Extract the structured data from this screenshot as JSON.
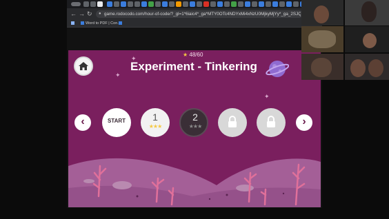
{
  "browser": {
    "url": "game.rodocodo.com/hour-of-code/?_gl=1*6iaic4*_ga*MTY0OTc4NDYxMi4xNzU0MjkyMjYy*_ga_2SJQ2SJ602*czE3...",
    "bookmarks": [
      "Word to PDF | Con..."
    ]
  },
  "game": {
    "star_count": "48/60",
    "title": "Experiment - Tinkering",
    "levels": [
      {
        "label": "START",
        "state": "start"
      },
      {
        "label": "1",
        "state": "complete",
        "stars": 3
      },
      {
        "label": "2",
        "state": "current",
        "stars": 3
      },
      {
        "label": "",
        "state": "locked"
      },
      {
        "label": "",
        "state": "locked"
      }
    ],
    "colors": {
      "background": "#7a1f5e",
      "ground": "#a45f97",
      "coral": "#e0709a",
      "star": "#f5c842"
    }
  }
}
